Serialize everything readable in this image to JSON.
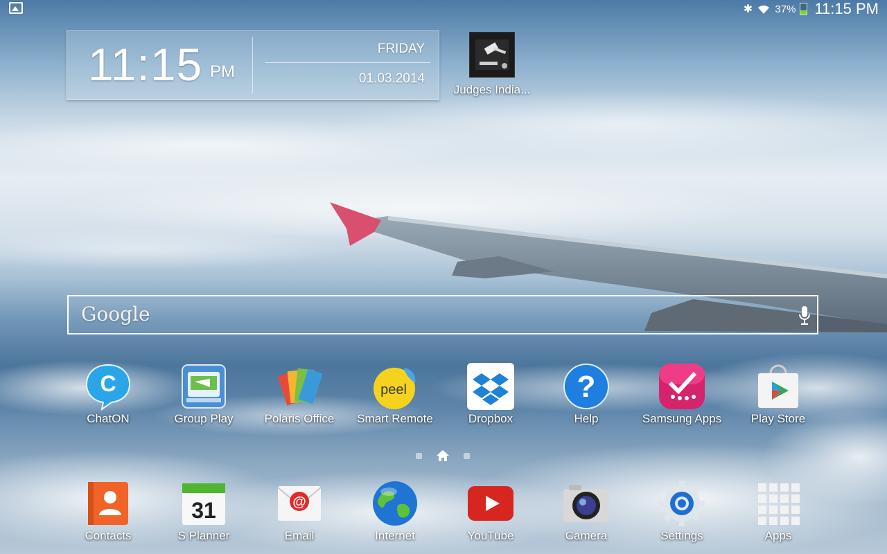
{
  "statusbar": {
    "battery_percent": "37%",
    "battery_level": 0.37,
    "time": "11:15 PM"
  },
  "clock": {
    "time": "11:15",
    "ampm": "PM",
    "day": "FRIDAY",
    "date": "01.03.2014"
  },
  "shortcut": {
    "label": "Judges India..."
  },
  "search": {
    "logo": "Google"
  },
  "apps_row": [
    {
      "label": "ChatON"
    },
    {
      "label": "Group Play"
    },
    {
      "label": "Polaris Office"
    },
    {
      "label": "Smart Remote"
    },
    {
      "label": "Dropbox"
    },
    {
      "label": "Help"
    },
    {
      "label": "Samsung Apps"
    },
    {
      "label": "Play Store"
    }
  ],
  "dock": [
    {
      "label": "Contacts"
    },
    {
      "label": "S Planner",
      "day_number": "31"
    },
    {
      "label": "Email"
    },
    {
      "label": "Internet"
    },
    {
      "label": "YouTube"
    },
    {
      "label": "Camera"
    },
    {
      "label": "Settings"
    },
    {
      "label": "Apps"
    }
  ],
  "icon_glyphs": {
    "chaton": "C",
    "help": "?",
    "email": "@",
    "peel": "peel"
  }
}
